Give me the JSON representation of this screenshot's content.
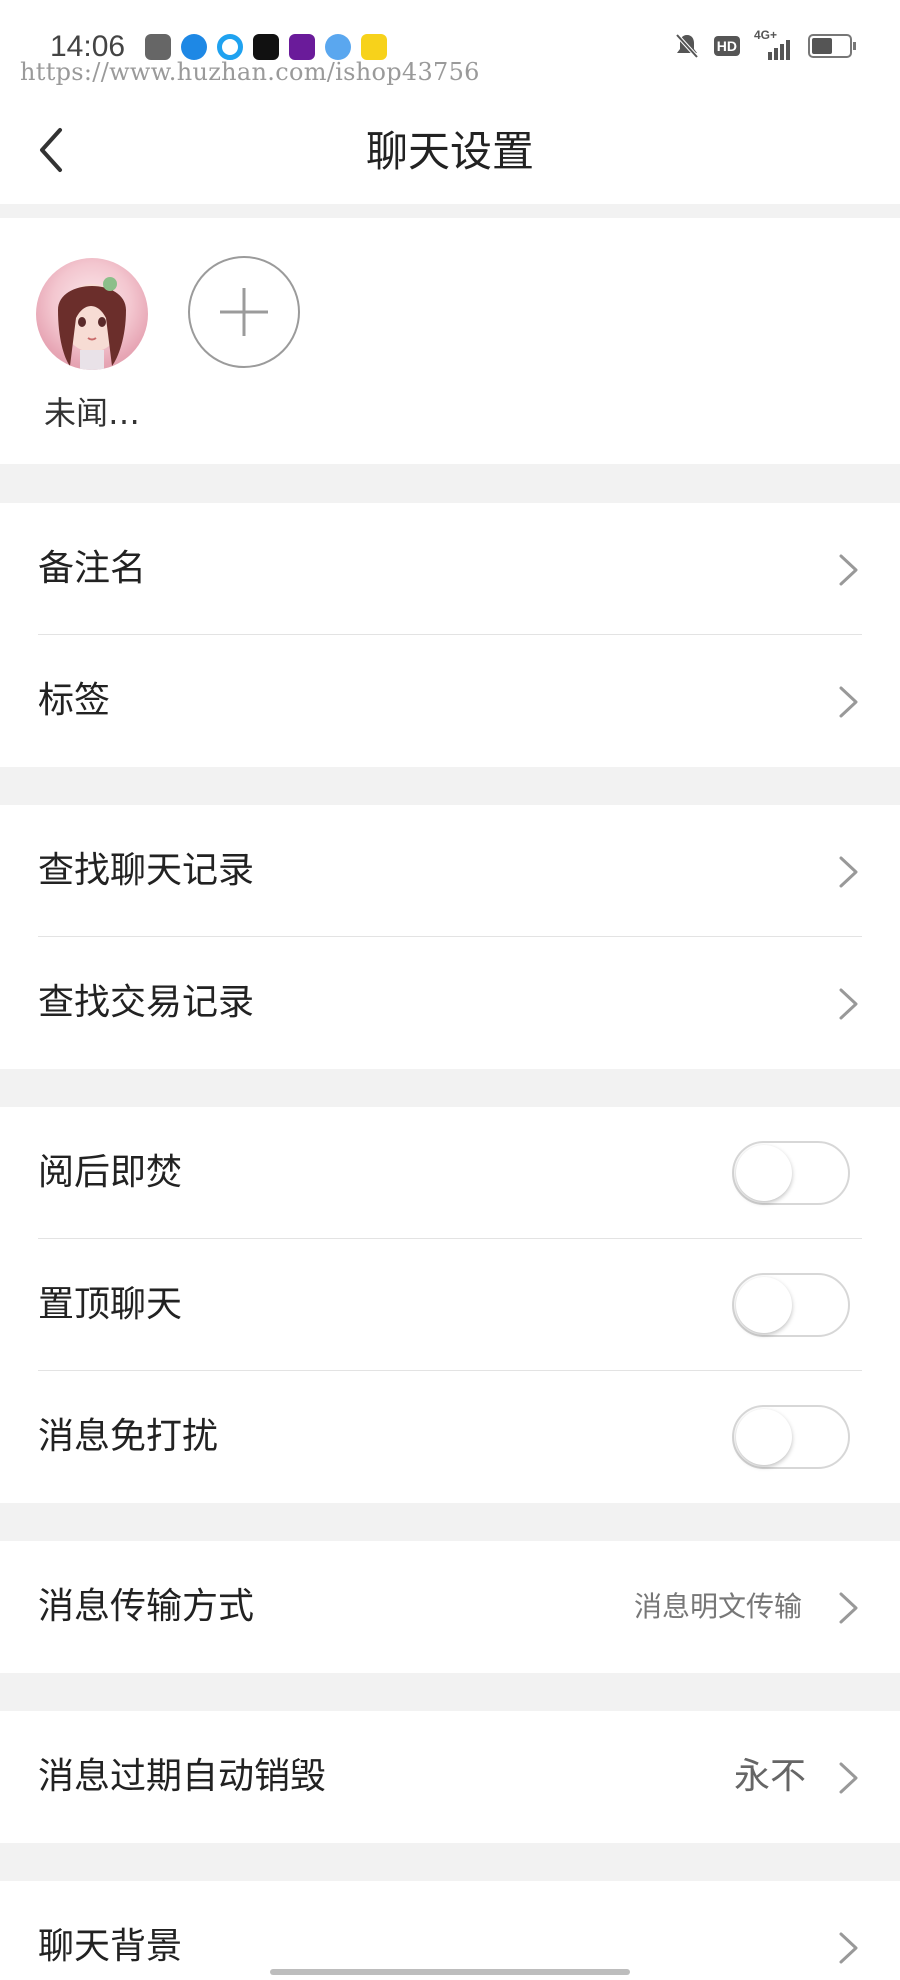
{
  "status_bar": {
    "time": "14:06",
    "watermark": "https://www.huzhan.com/ishop43756",
    "app_icons": [
      {
        "name": "game-icon",
        "color": "#555555"
      },
      {
        "name": "k-app-icon",
        "color": "#1e88e5"
      },
      {
        "name": "browser-icon",
        "color": "#1fa2f0"
      },
      {
        "name": "tiktok-icon",
        "color": "#111111"
      },
      {
        "name": "video-app-icon",
        "color": "#6a1b9a"
      },
      {
        "name": "cloud-icon",
        "color": "#3a8ee6"
      },
      {
        "name": "yellow-app-icon",
        "color": "#f7d21b"
      }
    ],
    "right_icons": [
      "bell-muted-icon",
      "hd-icon",
      "signal-4g-icon",
      "battery-icon"
    ],
    "network": "4G+",
    "hd": "HD"
  },
  "header": {
    "title": "聊天设置",
    "back_icon": "chevron-left-icon"
  },
  "members": {
    "items": [
      {
        "name": "未闻…",
        "avatar_icon": "avatar-girl-icon"
      }
    ],
    "add_icon": "plus-icon"
  },
  "sections": {
    "remark": {
      "label": "备注名"
    },
    "tags": {
      "label": "标签"
    },
    "find_chat": {
      "label": "查找聊天记录"
    },
    "find_trade": {
      "label": "查找交易记录"
    },
    "burn_after_read": {
      "label": "阅后即焚",
      "on": false
    },
    "pin_chat": {
      "label": "置顶聊天",
      "on": false
    },
    "mute": {
      "label": "消息免打扰",
      "on": false
    },
    "transfer_mode": {
      "label": "消息传输方式",
      "value": "消息明文传输"
    },
    "auto_destroy": {
      "label": "消息过期自动销毁",
      "value": "永不"
    },
    "background": {
      "label": "聊天背景"
    }
  },
  "colors": {
    "page_bg": "#f2f2f2",
    "card_bg": "#ffffff",
    "divider": "#e3e3e3",
    "text": "#222222",
    "secondary_text": "#777777"
  }
}
